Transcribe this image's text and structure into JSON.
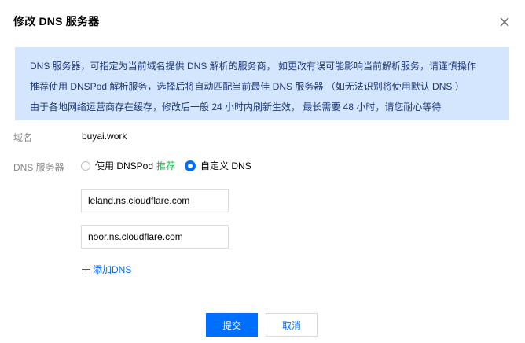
{
  "dialog": {
    "title": "修改 DNS 服务器",
    "close_icon": "close-icon"
  },
  "notice": {
    "lines": [
      "DNS 服务器，可指定为当前域名提供 DNS 解析的服务商， 如更改有误可能影响当前解析服务，请谨慎操作",
      "推荐使用 DNSPod 解析服务，选择后将自动匹配当前最佳 DNS 服务器 （如无法识别将使用默认 DNS ）",
      "由于各地网络运营商存在缓存，修改后一般 24 小时内刷新生效， 最长需要 48 小时，请您耐心等待"
    ],
    "background_color": "#d4e5fe"
  },
  "form": {
    "domain_label": "域名",
    "domain_value": "buyai.work",
    "dns_label": "DNS 服务器",
    "radio_dnspod_label": "使用 DNSPod",
    "radio_dnspod_recommend": "推荐",
    "radio_custom_label": "自定义 DNS",
    "selected_option": "自定义 DNS",
    "dns_servers": [
      "leland.ns.cloudflare.com",
      "noor.ns.cloudflare.com"
    ],
    "add_dns_label": "添加DNS",
    "add_dns_icon": "plus-icon"
  },
  "actions": {
    "submit_label": "提交",
    "cancel_label": "取消"
  },
  "colors": {
    "accent": "#006eff",
    "recommend": "#29b34f"
  }
}
